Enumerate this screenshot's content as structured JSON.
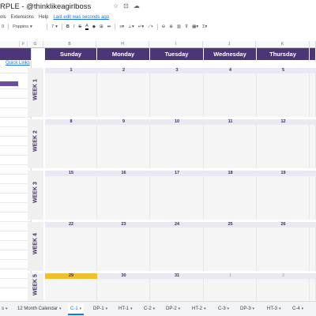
{
  "header": {
    "doc_title": "RPLE - @thinklikeagirlboss",
    "icons": [
      "star-icon",
      "move-folder-icon",
      "cloud-status-icon"
    ],
    "menu": [
      "ols",
      "Extensions",
      "Help"
    ],
    "last_edit": "Last edit was seconds ago"
  },
  "toolbar": {
    "font_size_visible": "0",
    "font_name": "Poppins",
    "font_size": "7",
    "bold": "B",
    "italic": "I",
    "strike": "S",
    "text_color": "A"
  },
  "columns": {
    "f": "F",
    "g": "G",
    "b": "B",
    "h": "H",
    "i": "I",
    "j": "J",
    "k": "K"
  },
  "sidebar": {
    "quick_links": "Quick Links"
  },
  "days": [
    "Sunday",
    "Monday",
    "Tuesday",
    "Wednesday",
    "Thursday"
  ],
  "weeks": [
    {
      "label": "WEEK 1",
      "dates": [
        "1",
        "2",
        "3",
        "4",
        "5"
      ]
    },
    {
      "label": "WEEK 2",
      "dates": [
        "8",
        "9",
        "10",
        "11",
        "12"
      ]
    },
    {
      "label": "WEEK 3",
      "dates": [
        "15",
        "16",
        "17",
        "18",
        "19"
      ]
    },
    {
      "label": "WEEK 4",
      "dates": [
        "22",
        "23",
        "24",
        "25",
        "26"
      ]
    },
    {
      "label": "WEEK 5",
      "dates": [
        "29",
        "30",
        "31",
        "1",
        "2"
      ]
    }
  ],
  "tabs": [
    {
      "label": "s"
    },
    {
      "label": "12 Month Calendar"
    },
    {
      "label": "C-1",
      "active": true
    },
    {
      "label": "DP-1"
    },
    {
      "label": "HT-1"
    },
    {
      "label": "C-2"
    },
    {
      "label": "DP-2"
    },
    {
      "label": "HT-2"
    },
    {
      "label": "C-3"
    },
    {
      "label": "DP-3"
    },
    {
      "label": "HT-3"
    },
    {
      "label": "C-4"
    }
  ],
  "colors": {
    "header_purple": "#4d3579",
    "accent_yellow": "#f0c02c",
    "week_text": "#3d2a66"
  }
}
